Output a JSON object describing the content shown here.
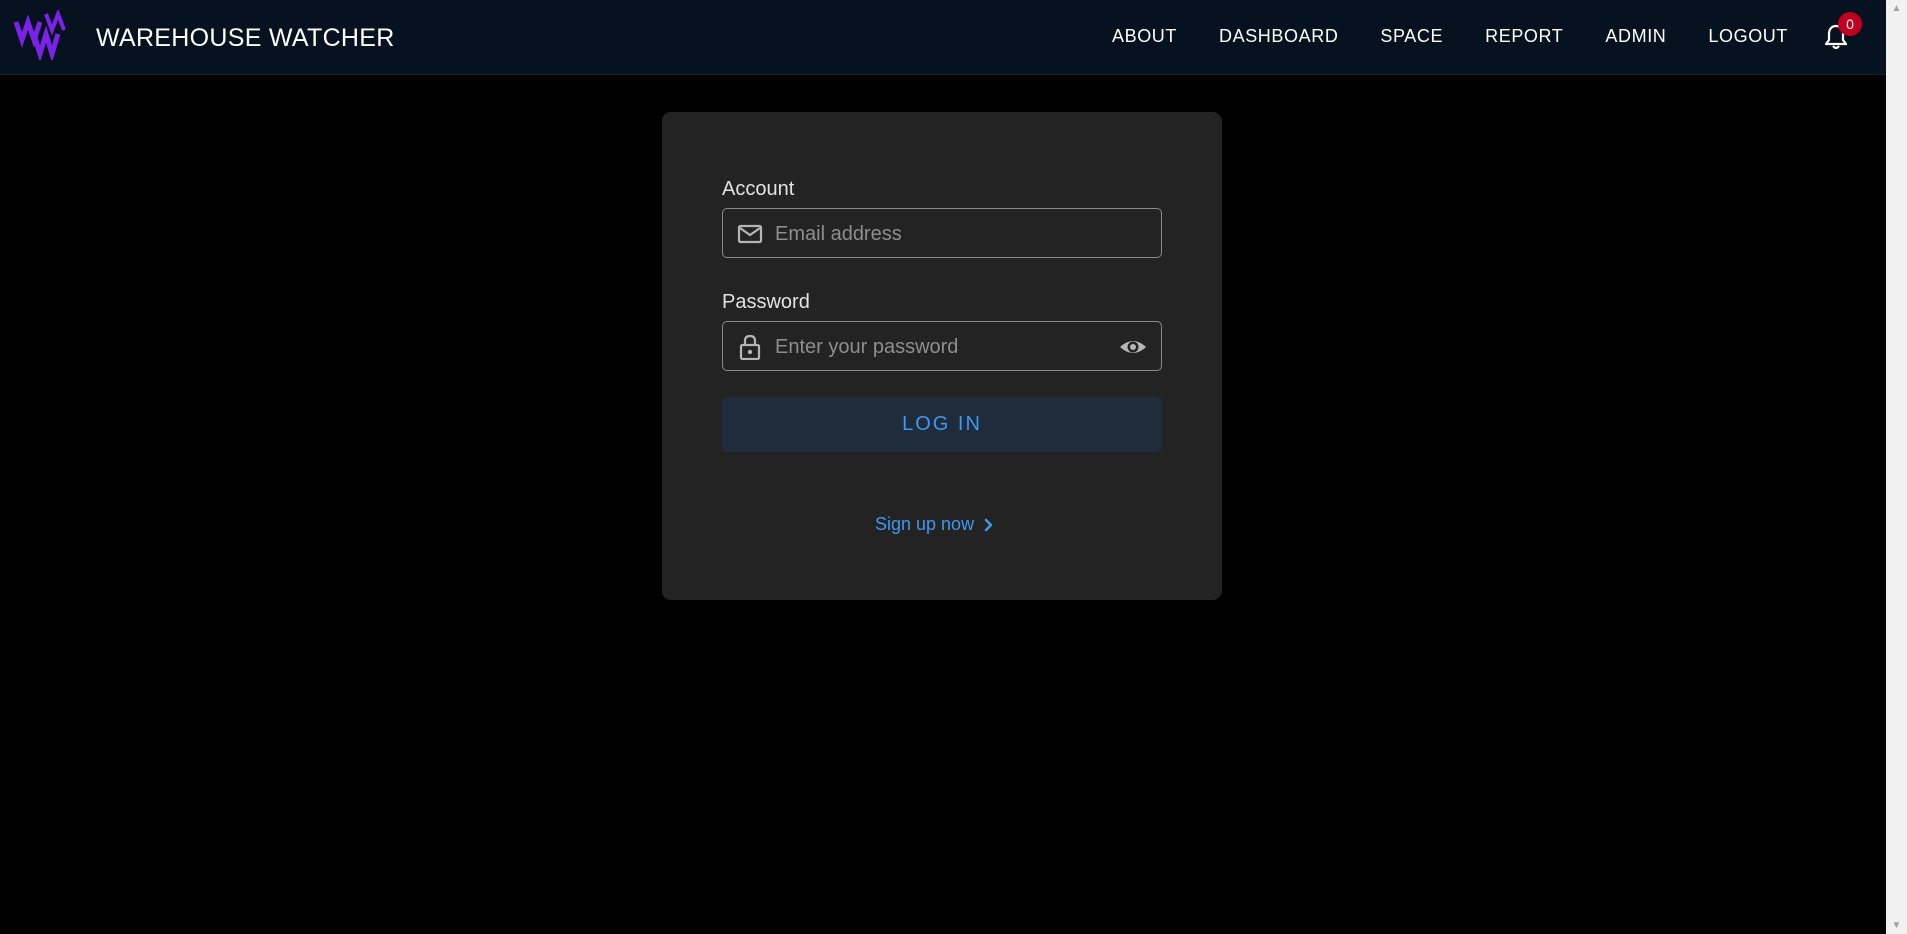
{
  "app": {
    "title": "WAREHOUSE WATCHER",
    "logo_icon": "ww-logo-icon"
  },
  "nav": {
    "items": [
      {
        "label": "ABOUT"
      },
      {
        "label": "DASHBOARD"
      },
      {
        "label": "SPACE"
      },
      {
        "label": "REPORT"
      },
      {
        "label": "ADMIN"
      },
      {
        "label": "LOGOUT"
      }
    ],
    "notifications": {
      "icon": "bell-icon",
      "count": "0"
    }
  },
  "login": {
    "account_label": "Account",
    "email_placeholder": "Email address",
    "email_value": "",
    "email_icon": "mail-icon",
    "password_label": "Password",
    "password_placeholder": "Enter your password",
    "password_value": "",
    "password_icon": "lock-icon",
    "visibility_icon": "eye-icon",
    "submit_label": "LOG IN",
    "signup_label": "Sign up now",
    "signup_icon": "chevron-right-icon"
  },
  "colors": {
    "navbar_bg": "#06121f",
    "page_bg": "#000000",
    "card_bg": "#232323",
    "accent": "#3f97f0",
    "badge": "#c0001f",
    "logo_purple": "#7a22e6"
  }
}
